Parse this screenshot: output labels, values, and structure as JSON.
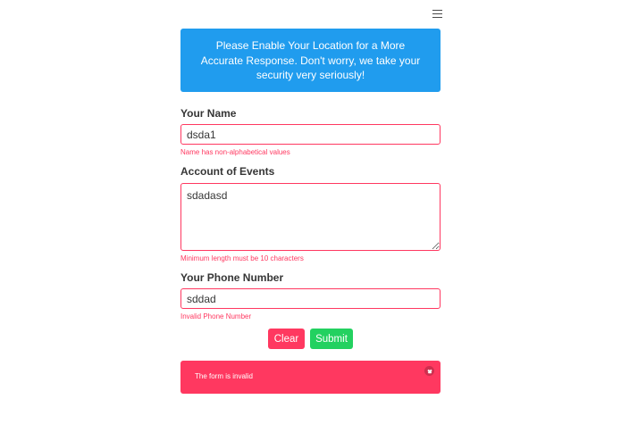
{
  "navbar": {
    "menu_icon": "hamburger-menu-icon"
  },
  "notice": {
    "text": "Please Enable Your Location for a More Accurate Response. Don't worry, we take your security very seriously!",
    "color": "#209cee"
  },
  "form": {
    "name": {
      "label": "Your Name",
      "value": "dsda1",
      "error": "Name has non-alphabetical values"
    },
    "events": {
      "label": "Account of Events",
      "value": "sdadasd",
      "error": "Minimum length must be 10 characters"
    },
    "phone": {
      "label": "Your Phone Number",
      "value": "sddad",
      "error": "Invalid Phone Number"
    },
    "clear_label": "Clear",
    "submit_label": "Submit"
  },
  "error_notification": {
    "text": "The form is invalid",
    "close_icon": "close-icon",
    "color": "#ff3860"
  }
}
